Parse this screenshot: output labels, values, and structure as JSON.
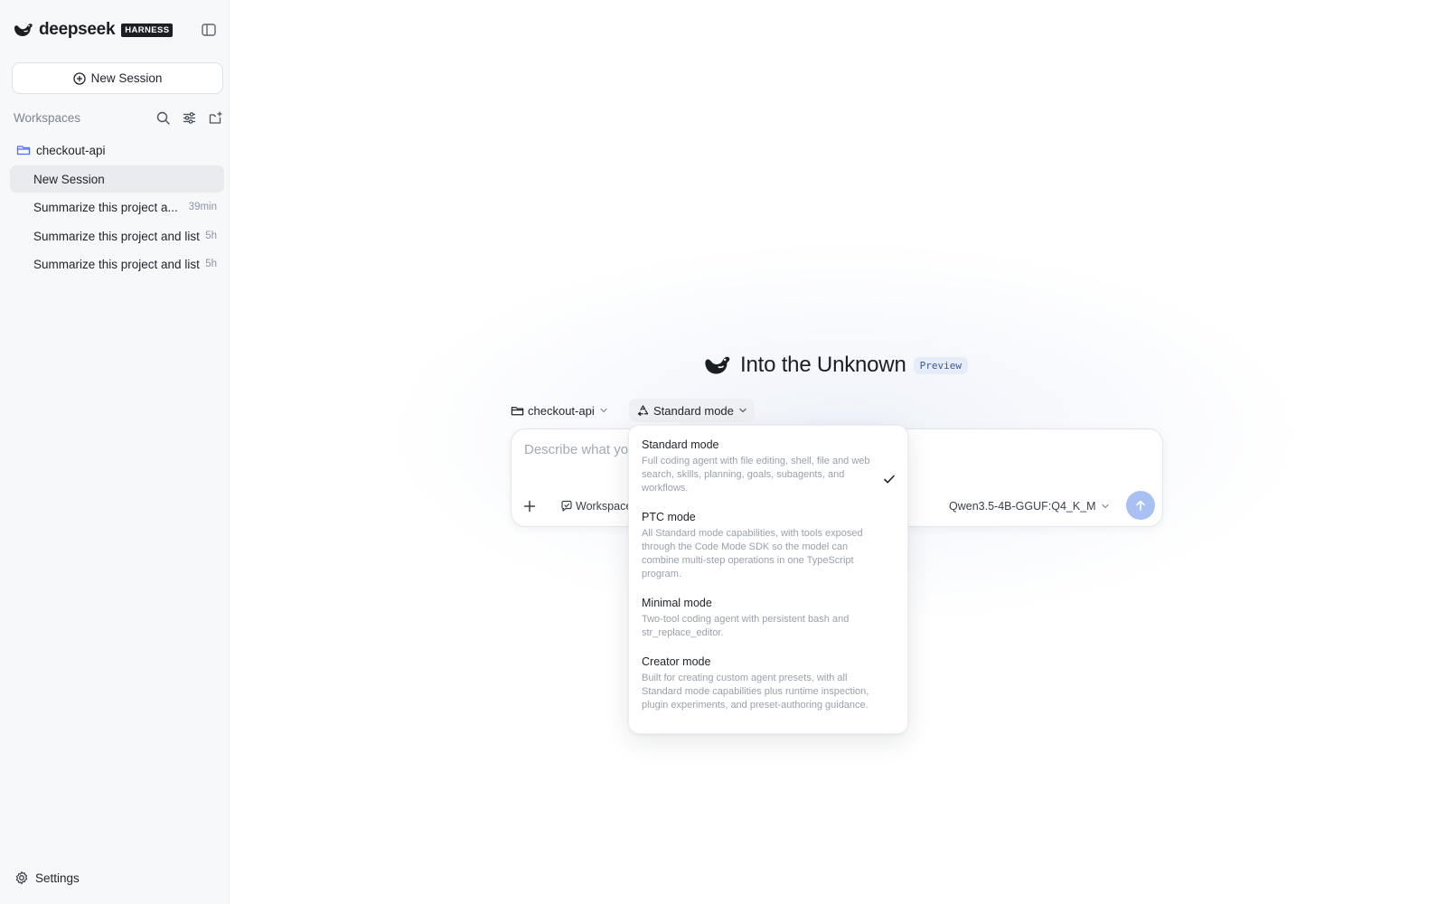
{
  "brand": {
    "name": "deepseek",
    "badge": "HARNESS"
  },
  "sidebar": {
    "new_session_label": "New Session",
    "workspaces_title": "Workspaces",
    "folder": {
      "label": "checkout-api"
    },
    "sessions": [
      {
        "label": "New Session",
        "time": ""
      },
      {
        "label": "Summarize this project a...",
        "time": "39min"
      },
      {
        "label": "Summarize this project and list",
        "time": "5h"
      },
      {
        "label": "Summarize this project and list",
        "time": "5h"
      }
    ],
    "settings_label": "Settings"
  },
  "hero": {
    "title": "Into the Unknown",
    "badge": "Preview"
  },
  "toolbar": {
    "workspace_chip": "checkout-api",
    "mode_chip": "Standard mode"
  },
  "composer": {
    "placeholder": "Describe what you want to build...",
    "workspace_chip": "Workspace",
    "model": "Qwen3.5-4B-GGUF:Q4_K_M"
  },
  "mode_menu": {
    "options": [
      {
        "title": "Standard mode",
        "desc": "Full coding agent with file editing, shell, file and web search, skills, planning, goals, subagents, and workflows.",
        "selected": true
      },
      {
        "title": "PTC mode",
        "desc": "All Standard mode capabilities, with tools exposed through the Code Mode SDK so the model can combine multi-step operations in one TypeScript program.",
        "selected": false
      },
      {
        "title": "Minimal mode",
        "desc": "Two-tool coding agent with persistent bash and str_replace_editor.",
        "selected": false
      },
      {
        "title": "Creator mode",
        "desc": "Built for creating custom agent presets, with all Standard mode capabilities plus runtime inspection, plugin experiments, and preset-authoring guidance.",
        "selected": false
      }
    ]
  },
  "colors": {
    "brand_blue": "#4d6bfe",
    "send_button": "#a8c0f2",
    "sidebar_bg": "#f7f8fa",
    "active_item_bg": "#e9ebee"
  }
}
